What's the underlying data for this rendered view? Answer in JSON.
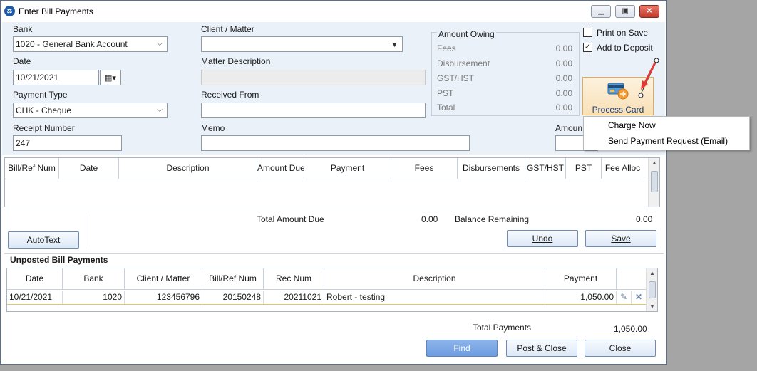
{
  "window": {
    "title": "Enter Bill Payments"
  },
  "titlebar": {
    "minimize_icon": "minimize-icon",
    "maximize_icon": "maximize-icon",
    "close_icon": "close-icon"
  },
  "form": {
    "bank_label": "Bank",
    "bank_value": "1020 - General Bank Account",
    "date_label": "Date",
    "date_value": "10/21/2021",
    "payment_type_label": "Payment Type",
    "payment_type_value": "CHK - Cheque",
    "receipt_number_label": "Receipt Number",
    "receipt_number_value": "247",
    "client_matter_label": "Client / Matter",
    "client_matter_value": "",
    "matter_description_label": "Matter Description",
    "matter_description_value": "",
    "received_from_label": "Received From",
    "received_from_value": "",
    "memo_label": "Memo",
    "memo_value": "",
    "amount_label": "Amoun"
  },
  "amount_owing": {
    "title": "Amount Owing",
    "rows": [
      {
        "label": "Fees",
        "value": "0.00"
      },
      {
        "label": "Disbursement",
        "value": "0.00"
      },
      {
        "label": "GST/HST",
        "value": "0.00"
      },
      {
        "label": "PST",
        "value": "0.00"
      },
      {
        "label": "Total",
        "value": "0.00"
      }
    ]
  },
  "options": {
    "print_on_save_label": "Print on Save",
    "print_on_save_checked": false,
    "add_to_deposit_label": "Add to Deposit",
    "add_to_deposit_checked": true
  },
  "process_card": {
    "label": "Process Card",
    "icon": "credit-card-icon"
  },
  "context_menu": {
    "items": [
      "Charge Now",
      "Send Payment Request (Email)"
    ]
  },
  "bills_grid": {
    "columns": [
      "Bill/Ref Num",
      "Date",
      "Description",
      "Amount Due",
      "Payment",
      "Fees",
      "Disbursements",
      "GST/HST",
      "PST",
      "Fee Alloc"
    ]
  },
  "totals": {
    "total_amount_due_label": "Total Amount Due",
    "total_amount_due_value": "0.00",
    "balance_remaining_label": "Balance Remaining",
    "balance_remaining_value": "0.00"
  },
  "buttons": {
    "autotext": "AutoText",
    "undo": "Undo",
    "save": "Save",
    "find": "Find",
    "post_close": "Post & Close",
    "close": "Close"
  },
  "unposted": {
    "title": "Unposted Bill Payments",
    "columns": [
      "Date",
      "Bank",
      "Client / Matter",
      "Bill/Ref Num",
      "Rec Num",
      "Description",
      "Payment"
    ],
    "rows": [
      {
        "date": "10/21/2021",
        "bank": "1020",
        "client_matter": "123456796",
        "bill_ref": "20150248",
        "rec_num": "20211021",
        "description": "Robert - testing",
        "payment": "1,050.00"
      }
    ],
    "total_label": "Total Payments",
    "total_value": "1,050.00"
  }
}
